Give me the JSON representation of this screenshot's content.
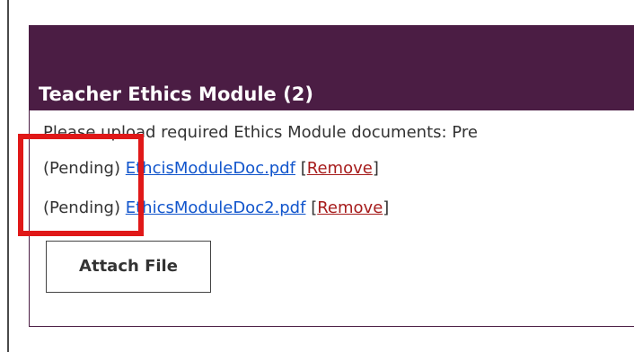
{
  "panel": {
    "title": "Teacher Ethics Module (2)",
    "instructions": "Please upload required Ethics Module documents: Pre"
  },
  "files": [
    {
      "status": "(Pending)",
      "name": "EthcisModuleDoc.pdf",
      "bracket_open": "[",
      "remove_label": "Remove",
      "bracket_close": "]"
    },
    {
      "status": "(Pending)",
      "name": "EthicsModuleDoc2.pdf",
      "bracket_open": "[",
      "remove_label": "Remove",
      "bracket_close": "]"
    }
  ],
  "attach_button_label": "Attach File",
  "colors": {
    "header_bg": "#4b1d44",
    "link": "#1155cc",
    "remove_link": "#a61c1c",
    "highlight": "#e01818"
  }
}
